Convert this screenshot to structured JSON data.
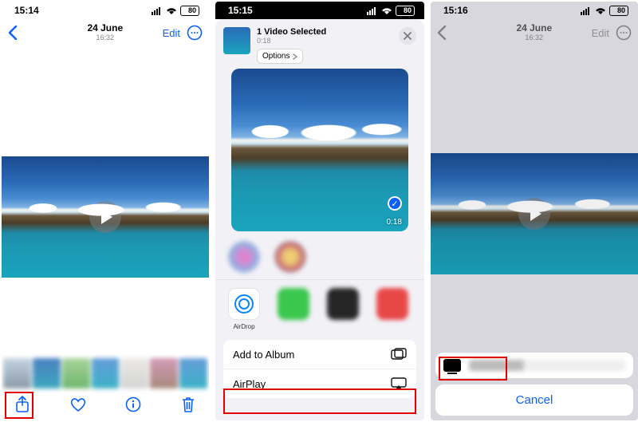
{
  "phone1": {
    "status_time": "15:14",
    "battery": "80",
    "date": "24 June",
    "time": "16:32",
    "edit": "Edit",
    "toolbar": {
      "share": "share",
      "heart": "heart",
      "info": "info",
      "trash": "trash"
    }
  },
  "phone2": {
    "status_time": "15:15",
    "battery": "80",
    "title": "1 Video Selected",
    "duration": "0:18",
    "options": "Options",
    "thumb_duration": "0:18",
    "airdrop": "AirDrop",
    "actions": {
      "add_to_album": "Add to Album",
      "airplay": "AirPlay"
    }
  },
  "phone3": {
    "status_time": "15:16",
    "battery": "80",
    "date": "24 June",
    "time": "16:32",
    "edit": "Edit",
    "cancel": "Cancel"
  }
}
